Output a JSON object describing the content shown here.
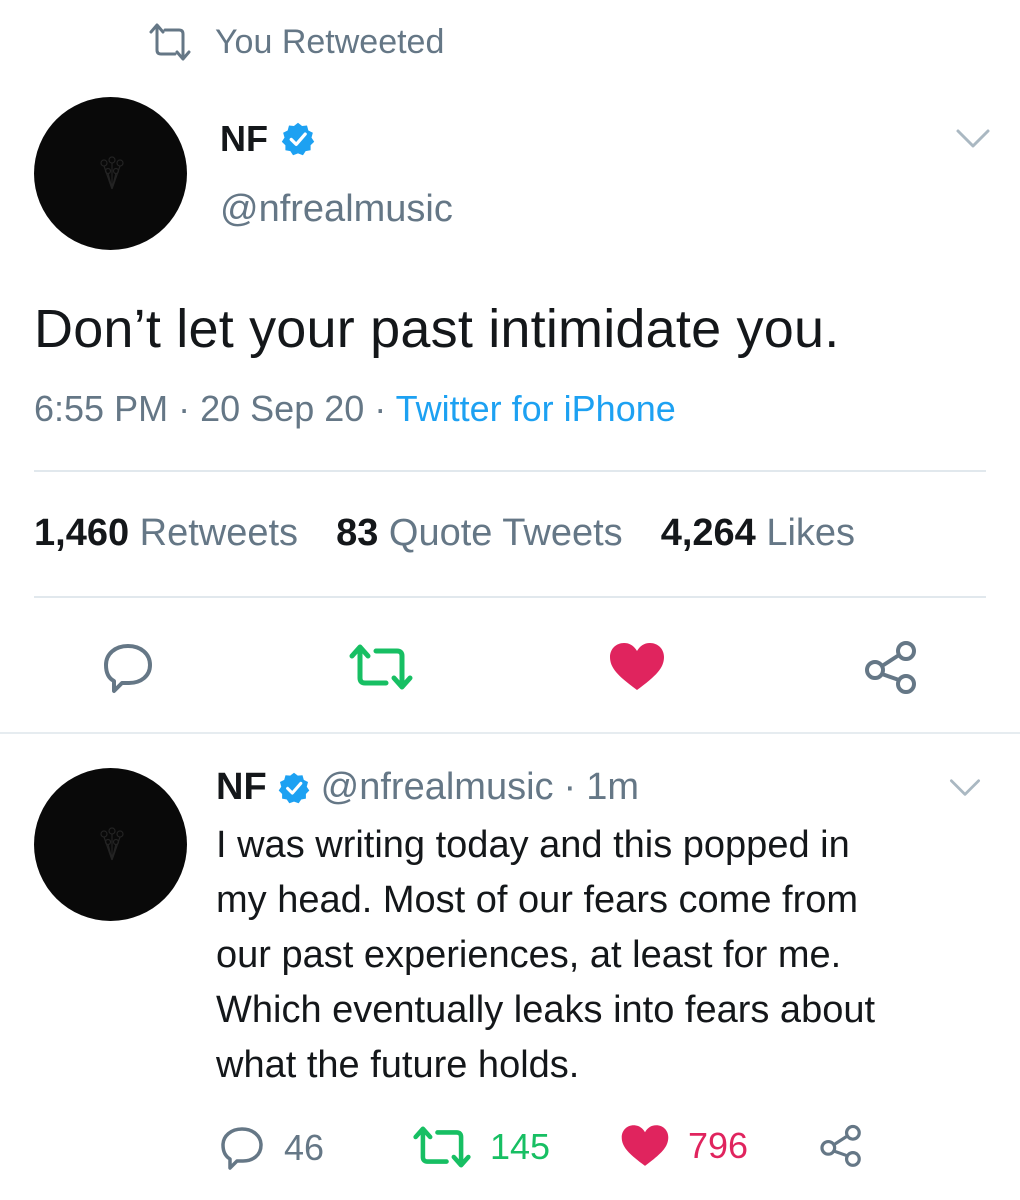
{
  "retweet_context": {
    "label": "You Retweeted",
    "icon": "retweet-icon"
  },
  "main_tweet": {
    "author_name": "NF",
    "verified": true,
    "handle": "@nfrealmusic",
    "text": "Don’t let your past intimidate you.",
    "time": "6:55 PM",
    "separator": "·",
    "date": "20 Sep 20",
    "source": "Twitter for iPhone",
    "stats": {
      "retweets_count": "1,460",
      "retweets_label": "Retweets",
      "quotes_count": "83",
      "quotes_label": "Quote Tweets",
      "likes_count": "4,264",
      "likes_label": "Likes"
    },
    "retweeted_by_user": true,
    "liked_by_user": true
  },
  "reply_tweet": {
    "author_name": "NF",
    "verified": true,
    "handle": "@nfrealmusic",
    "separator": "·",
    "time_ago": "1m",
    "text_lines": [
      "I was writing today and this popped in",
      "my head. Most of our fears come from",
      "our past experiences, at least for me.",
      "Which eventually leaks into fears about",
      "what the future holds."
    ],
    "reply_count": "46",
    "retweet_count": "145",
    "like_count": "796"
  },
  "colors": {
    "text": "#14171a",
    "secondary": "#657786",
    "link": "#1da1f2",
    "retweet_green": "#17bf63",
    "like_red": "#e0245e",
    "verified_blue": "#1da1f2",
    "divider": "#e1e8ed"
  }
}
